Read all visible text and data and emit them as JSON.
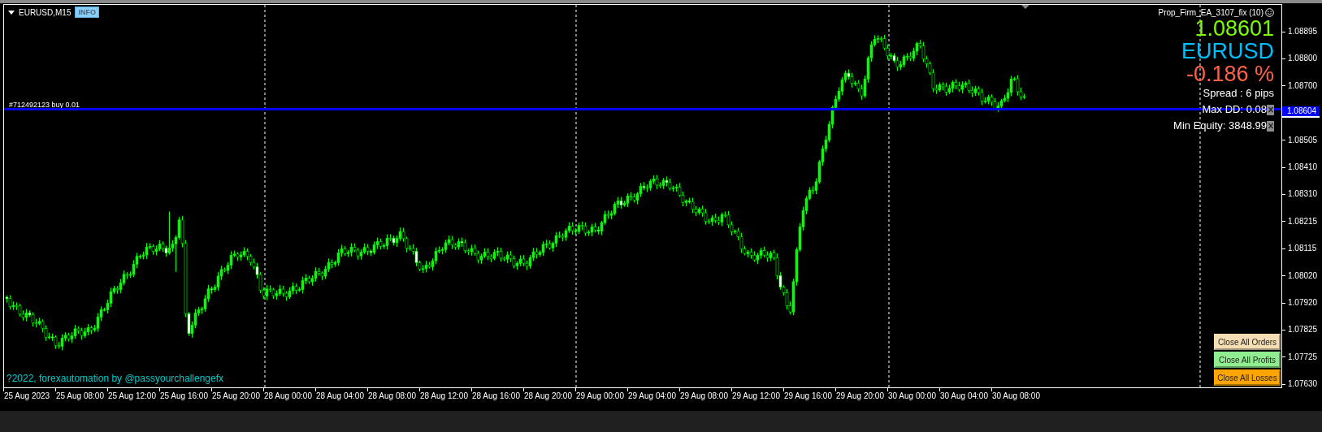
{
  "chart_header": {
    "symbol": "EURUSD,M15",
    "info_button": "INFO"
  },
  "order_line": {
    "label": "#712492123 buy 0.01",
    "price_label": "1.08604"
  },
  "ea_panel": {
    "title": "Prop_Firm_EA_3107_fix (10)",
    "price": "1.08601",
    "symbol": "EURUSD",
    "change": "-0.186 %",
    "spread": "Spread : 6 pips",
    "max_dd": "Max DD: 0.08",
    "min_equity": "Min Equity: 3848.99"
  },
  "buttons": [
    {
      "label": "Close All Orders",
      "color": "#f5deb3"
    },
    {
      "label": "Close All Profits",
      "color": "#90ee90"
    },
    {
      "label": "Close All Losses",
      "color": "#ffa500"
    }
  ],
  "copyright": "?2022, forexautomation by @passyourchallengefx",
  "price_axis": [
    "1.08895",
    "1.08800",
    "1.08700",
    "1.08505",
    "1.08410",
    "1.08310",
    "1.08215",
    "1.08115",
    "1.08020",
    "1.07920",
    "1.07825",
    "1.07725",
    "1.07630"
  ],
  "time_axis": [
    "25 Aug 2023",
    "25 Aug 08:00",
    "25 Aug 12:00",
    "25 Aug 16:00",
    "25 Aug 20:00",
    "28 Aug 00:00",
    "28 Aug 04:00",
    "28 Aug 08:00",
    "28 Aug 12:00",
    "28 Aug 16:00",
    "28 Aug 20:00",
    "29 Aug 00:00",
    "29 Aug 04:00",
    "29 Aug 08:00",
    "29 Aug 12:00",
    "29 Aug 16:00",
    "29 Aug 20:00",
    "30 Aug 00:00",
    "30 Aug 04:00",
    "30 Aug 08:00"
  ]
}
